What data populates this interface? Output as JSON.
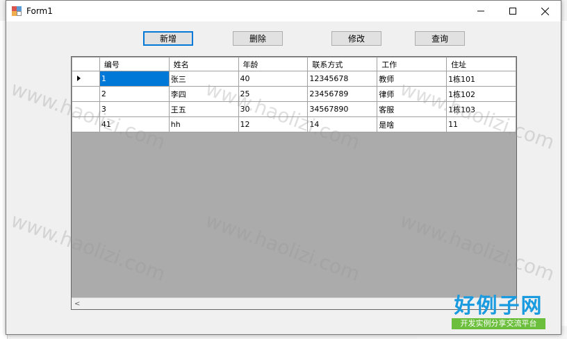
{
  "window": {
    "title": "Form1"
  },
  "toolbar": {
    "add_label": "新增",
    "delete_label": "删除",
    "edit_label": "修改",
    "query_label": "查询"
  },
  "grid": {
    "columns": [
      "编号",
      "姓名",
      "年龄",
      "联系方式",
      "工作",
      "住址"
    ],
    "rows": [
      [
        "1",
        "张三",
        "40",
        "12345678",
        "教师",
        "1栋101"
      ],
      [
        "2",
        "李四",
        "25",
        "23456789",
        "律师",
        "1栋102"
      ],
      [
        "3",
        "王五",
        "30",
        "34567890",
        "客服",
        "1栋103"
      ],
      [
        "41",
        "hh",
        "12",
        "14",
        "是啥",
        "11"
      ]
    ]
  },
  "watermark": {
    "text": "www.haolizi.com"
  },
  "logo": {
    "main": "好例子网",
    "sub": "开发实例分享交流平台"
  },
  "colors": {
    "selection": "#0078d7",
    "grid_background": "#ababab",
    "logo_blue": "#1a9be0",
    "logo_green": "#6bbf3c"
  }
}
